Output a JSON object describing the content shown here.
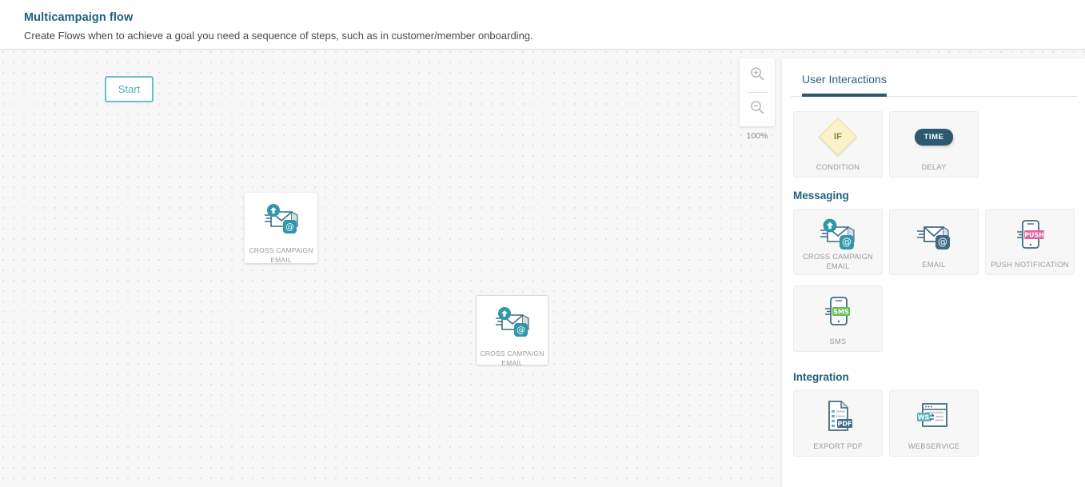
{
  "header": {
    "title": "Multicampaign flow",
    "subtitle": "Create Flows when to achieve a goal you need a sequence of steps, such as in customer/member onboarding."
  },
  "canvas": {
    "start_node": {
      "label": "Start"
    },
    "zoom": {
      "level": "100%",
      "zoom_in_icon": "zoom-in-icon",
      "zoom_out_icon": "zoom-out-icon"
    },
    "nodes": [
      {
        "label": "CROSS CAMPAIGN EMAIL",
        "icon": "cross-campaign-email-icon"
      },
      {
        "label": "CROSS CAMPAIGN EMAIL",
        "icon": "cross-campaign-email-icon"
      }
    ]
  },
  "panel": {
    "tabs": [
      {
        "label": "User Interactions",
        "active": true
      }
    ],
    "user_interactions": {
      "tiles": [
        {
          "label": "CONDITION",
          "icon": "condition-diamond-icon",
          "badge": "IF"
        },
        {
          "label": "DELAY",
          "icon": "delay-time-icon",
          "badge": "TIME"
        }
      ]
    },
    "messaging": {
      "title": "Messaging",
      "tiles": [
        {
          "label": "CROSS CAMPAIGN EMAIL",
          "icon": "cross-campaign-email-icon"
        },
        {
          "label": "EMAIL",
          "icon": "email-icon"
        },
        {
          "label": "PUSH NOTIFICATION",
          "icon": "push-notification-icon",
          "badge": "PUSH"
        },
        {
          "label": "SMS",
          "icon": "sms-icon",
          "badge": "SMS"
        }
      ]
    },
    "integration": {
      "title": "Integration",
      "tiles": [
        {
          "label": "EXPORT PDF",
          "icon": "export-pdf-icon",
          "badge": "PDF"
        },
        {
          "label": "WEBSERVICE",
          "icon": "webservice-icon",
          "badge": "WS"
        }
      ]
    }
  },
  "colors": {
    "brand_navy": "#2d5872",
    "teal": "#3aa0ac",
    "start_border": "#6cbcc4",
    "condition_yellow": "#faf2c8",
    "push_pink": "#e濃",
    "sms_green": "#67c05a",
    "canvas_bg": "#f7f7f7"
  }
}
